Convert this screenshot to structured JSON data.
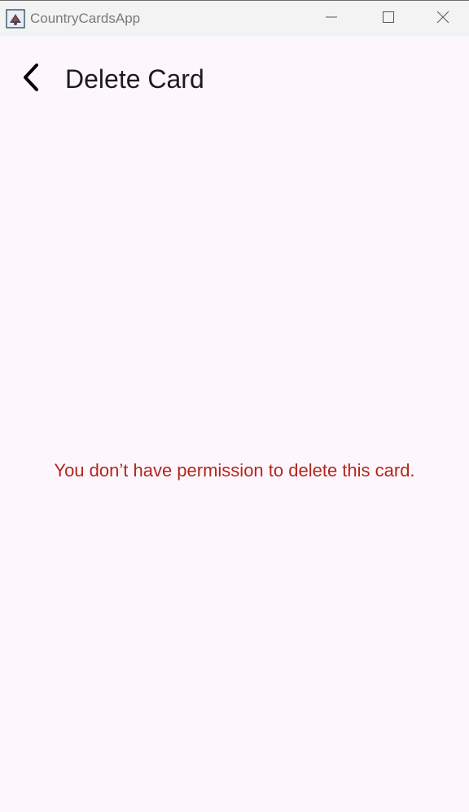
{
  "window": {
    "title": "CountryCardsApp",
    "icons": {
      "app": "java-app-icon",
      "minimize": "minimize-icon",
      "maximize": "maximize-icon",
      "close": "close-icon"
    }
  },
  "header": {
    "back_icon": "chevron-left-icon",
    "title": "Delete Card"
  },
  "body": {
    "message": "You don’t have permission to delete this card."
  },
  "colors": {
    "background": "#fdf7fd",
    "titlebar": "#f3f3f3",
    "error_text": "#b3261e",
    "title_text": "#1d1b20"
  }
}
